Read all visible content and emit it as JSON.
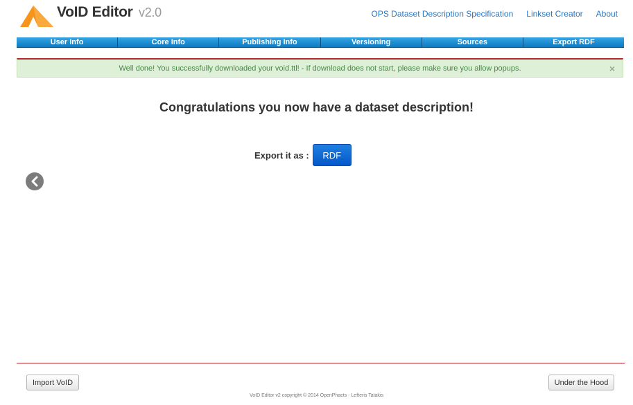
{
  "header": {
    "app_name": "VoID Editor",
    "version": "v2.0",
    "links": [
      "OPS Dataset Description Specification",
      "Linkset Creator",
      "About"
    ],
    "logo_icon": "orange-tent-triangle-logo"
  },
  "tabs": [
    "User Info",
    "Core Info",
    "Publishing Info",
    "Versioning",
    "Sources",
    "Export RDF"
  ],
  "alert": {
    "message": "Well done! You successfully downloaded your void.ttl! - If download does not start, please make sure you allow popups.",
    "close": "×"
  },
  "main": {
    "heading": "Congratulations you now have a dataset description!",
    "export_label": "Export it as :",
    "rdf_button": "RDF",
    "prev_icon": "chevron-left-icon"
  },
  "footer": {
    "import_button": "Import VoID",
    "hood_button": "Under the Hood",
    "copyright": "VoID Editor v2 copyright © 2014 OpenPhacts - Lefteris Tatakis"
  },
  "colors": {
    "tab_blue": "#1a8cd8",
    "alert_green": "#dff0d8",
    "alert_text": "#468847",
    "divider_red": "#b32b2b",
    "button_blue": "#0a67d4",
    "logo_orange": "#f7941d"
  }
}
